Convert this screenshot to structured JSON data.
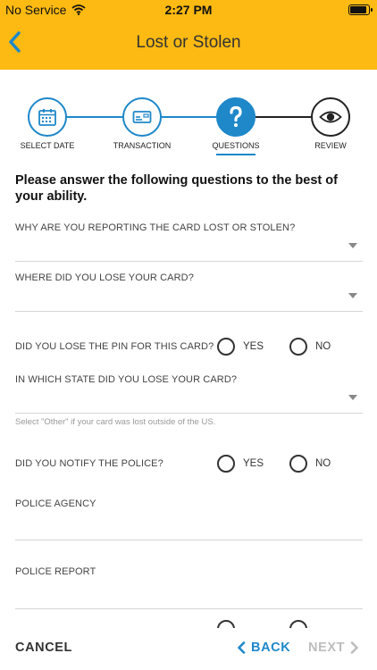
{
  "status_bar": {
    "carrier": "No Service",
    "time": "2:27 PM"
  },
  "header": {
    "title": "Lost or Stolen",
    "background": "#FDBA12"
  },
  "stepper": {
    "steps": [
      {
        "label": "SELECT DATE",
        "icon": "calendar-icon",
        "state": "complete"
      },
      {
        "label": "TRANSACTION",
        "icon": "card-icon",
        "state": "complete"
      },
      {
        "label": "QUESTIONS",
        "icon": "question-icon",
        "state": "active"
      },
      {
        "label": "REVIEW",
        "icon": "eye-icon",
        "state": "todo"
      }
    ],
    "accent": "#1E88C9"
  },
  "form": {
    "instructions": "Please answer the following questions to the best of your ability.",
    "why_label": "WHY ARE YOU REPORTING THE CARD LOST OR STOLEN?",
    "where_label": "WHERE DID YOU LOSE YOUR CARD?",
    "pin_label": "DID YOU LOSE THE PIN FOR THIS CARD?",
    "state_label": "IN WHICH STATE DID YOU LOSE YOUR CARD?",
    "state_helper": "Select \"Other\" if your card was lost outside of the US.",
    "police_label": "DID YOU NOTIFY THE POLICE?",
    "agency_label": "POLICE AGENCY",
    "report_label": "POLICE REPORT",
    "yes": "YES",
    "no": "NO"
  },
  "footer": {
    "cancel": "CANCEL",
    "back": "BACK",
    "next": "NEXT"
  }
}
